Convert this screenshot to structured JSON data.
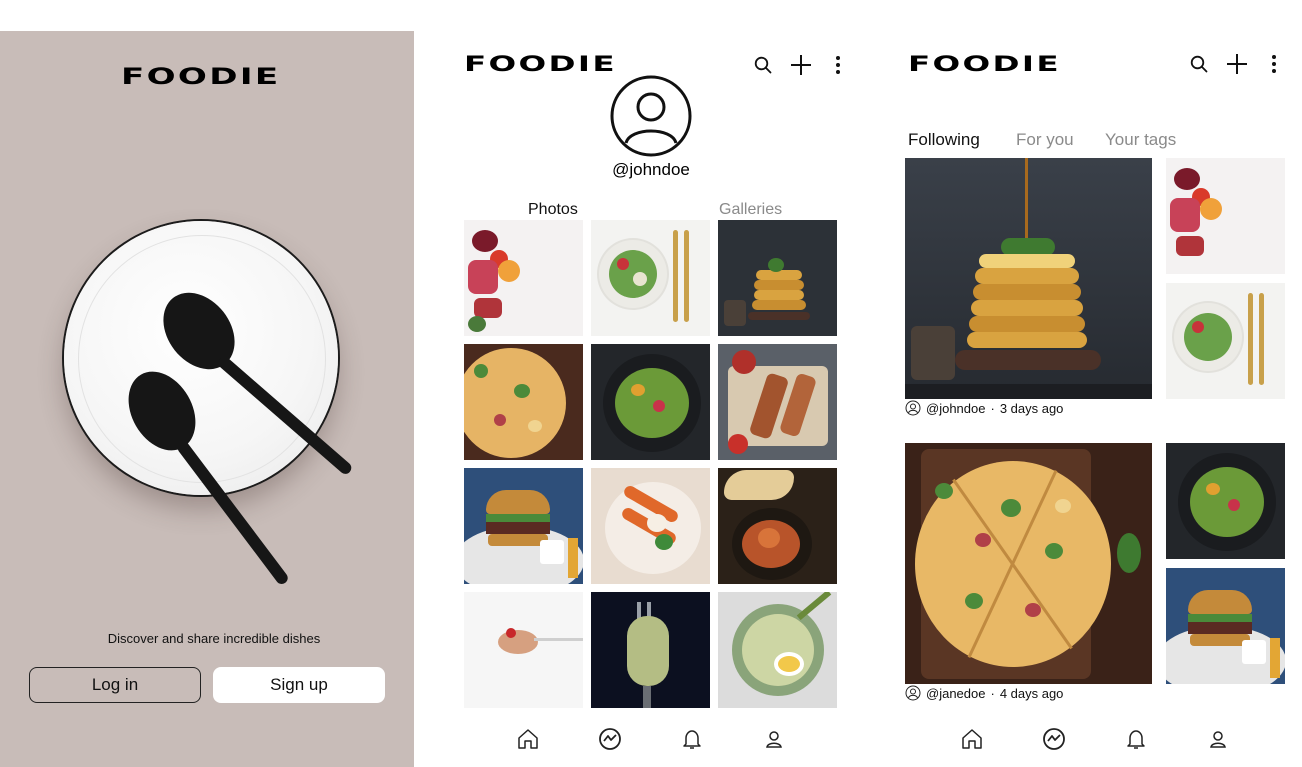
{
  "app": {
    "logo": "FOODIE"
  },
  "landing": {
    "tagline": "Discover and share incredible dishes",
    "login_label": "Log in",
    "signup_label": "Sign up",
    "background_color": "#c8bcb8"
  },
  "profile": {
    "username": "@johndoe",
    "tabs": {
      "photos": "Photos",
      "galleries": "Galleries"
    },
    "active_tab": "Photos",
    "photos": [
      "fruit-flatlay",
      "salad-bowl",
      "pancake-stack",
      "pizza",
      "green-salad-dark",
      "grilled-skewers",
      "burger-fries",
      "sweet-potato-bowl",
      "fried-chicken-naan",
      "spoonful-rice",
      "pasta-fork",
      "egg-salad-bowl"
    ]
  },
  "feed": {
    "tabs": {
      "following": "Following",
      "for_you": "For you",
      "your_tags": "Your tags"
    },
    "active_tab": "Following",
    "posts": [
      {
        "user": "@johndoe",
        "time": "3 days ago",
        "main": "pancake-stack",
        "side": [
          "fruit-flatlay",
          "salad-bowl"
        ]
      },
      {
        "user": "@janedoe",
        "time": "4 days ago",
        "main": "pizza",
        "side": [
          "green-salad-dark",
          "burger-fries"
        ]
      }
    ]
  },
  "nav": [
    "home-icon",
    "explore-icon",
    "bell-icon",
    "profile-icon"
  ],
  "header_icons": [
    "search-icon",
    "plus-icon",
    "more-vertical-icon"
  ],
  "colors": {
    "text": "#111111",
    "muted": "#8a8a8a",
    "accent": "#000000"
  }
}
